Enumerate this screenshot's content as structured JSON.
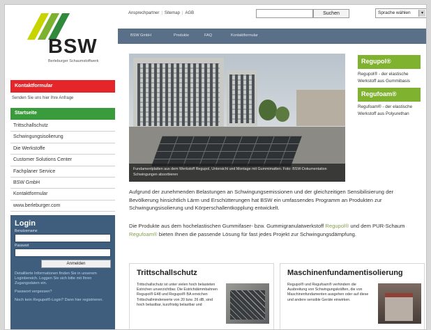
{
  "logo": {
    "name": "BSW",
    "subtitle": "Berleburger Schaumstoffwerk"
  },
  "sidebar": {
    "kontakt_title": "Kontaktformular",
    "kontakt_sub": "Senden Sie uns hier Ihre Anfrage",
    "startseite": "Startseite",
    "items": [
      {
        "label": "Trittschallschutz"
      },
      {
        "label": "Schwingungsisolierung"
      },
      {
        "label": "Die Werkstoffe"
      },
      {
        "label": "Customer Solutions Center"
      },
      {
        "label": "Fachplaner Service"
      },
      {
        "label": "BSW GmbH"
      },
      {
        "label": "Kontaktformular"
      },
      {
        "label": "www.berleburger.com"
      }
    ]
  },
  "login": {
    "title": "Login",
    "user_label": "Benutzername",
    "pass_label": "Passwort",
    "button": "Anmelden",
    "text1": "Detaillierte Informationen finden Sie in unserem Loginbereich. Loggen Sie sich bitte mit Ihren Zugangsdaten ein.",
    "text2": "Passwort vergessen?",
    "text3": "Noch kein Regupol®-Login? Dann hier registrieren."
  },
  "topbar": {
    "links": [
      "Ansprechpartner",
      "Sitemap",
      "AGB"
    ],
    "search_placeholder": "",
    "search_button": "Suchen",
    "language_select": "Sprache wählen"
  },
  "navbar": {
    "items": [
      "BSW GmbH",
      "Produkte",
      "FAQ",
      "Kontaktformular"
    ]
  },
  "hero": {
    "caption": "Fundamentplatten aus dem Werkstoff Regupol, Untersicht und Montage mit Gummimatten. Foto: BSW-Dokumentation Schwingungen absorbieren"
  },
  "side": {
    "regupol_title": "Regupol®",
    "regupol_text": "Regupol® - der elastische Werkstoff aus Gummibasis",
    "regufoam_title": "Regufoam®",
    "regufoam_text": "Regufoam® - der elastische Werkstoff aus Polyurethan"
  },
  "content": {
    "p1": "Aufgrund der zunehmenden Belastungen an Schwingungsemissionen und der gleichzeitigen Sensibilisierung der Bevölkerung hinsichtlich Lärm und Erschütterungen hat BSW ein umfassendes Programm an Produkten zur Schwingungsisolierung und Körperschallentkopplung entwickelt.",
    "p2_pre": "Die Produkte aus dem hochelastischen Gummifaser- bzw. Gummigranulatwerkstoff ",
    "p2_link1": "Regupol®",
    "p2_mid": " und dem PUR-Schaum ",
    "p2_link2": "Regufoam®",
    "p2_post": " bieten Ihnen die passende Lösung für fast jedes Projekt zur Schwingungsdämpfung."
  },
  "cards": [
    {
      "title": "Trittschallschutz",
      "text": "Trittschallschutz ist unter vielen hoch belasteten Estrichen unverzichtbar. Die Estrichdämmbahnen Regupol® E48 und Regupol® BA erreichen Trittschallminderwerte von 20 bzw. 26 dB, sind hoch belastbar, kurzfristig belastbar und"
    },
    {
      "title": "Maschinenfundamentisolierung",
      "text": "Regupol® und Regufoam® verhindern die Ausbreitung von Schwingungskräften, die von Maschinenfundamenten ausgehen oder auf diese und andere sensible Geräte einwirken."
    }
  ]
}
